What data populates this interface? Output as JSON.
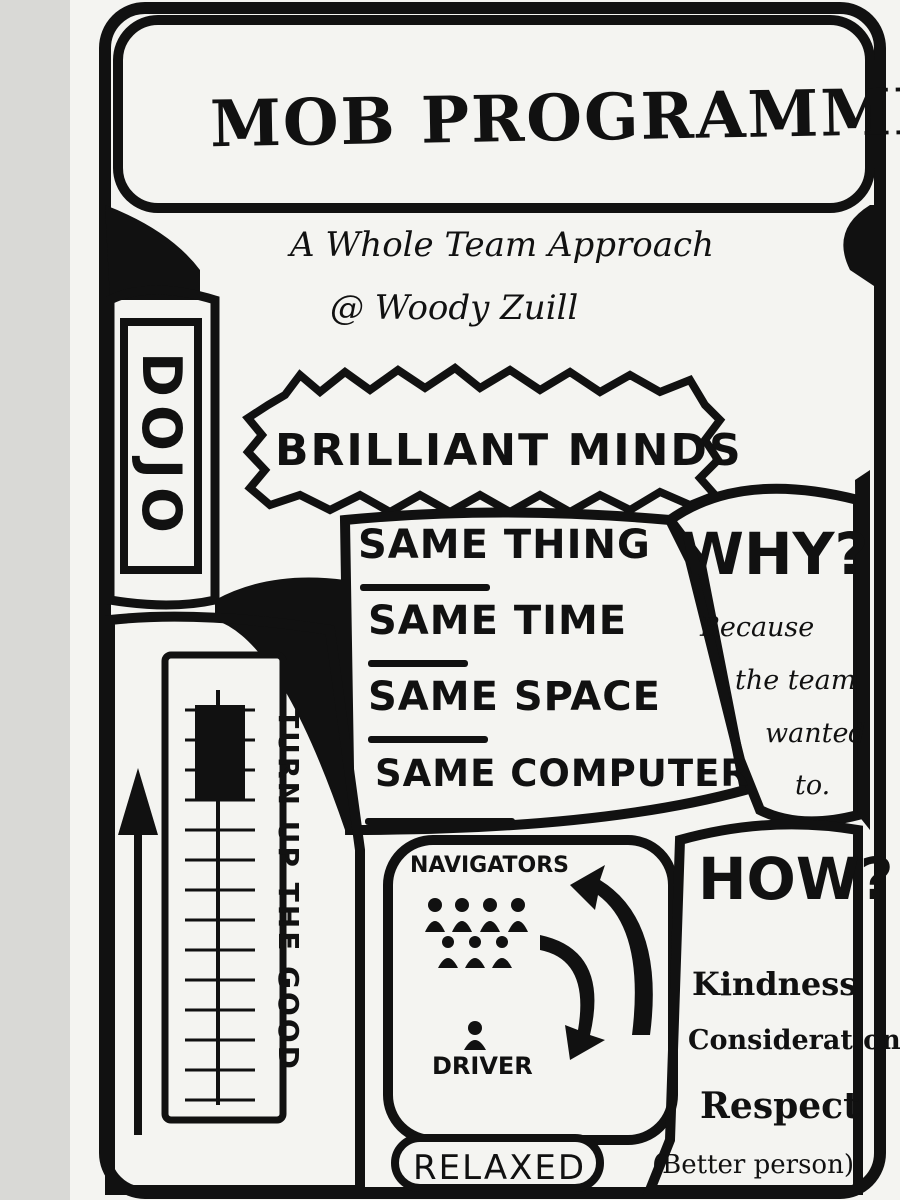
{
  "title": "MOB PROGRAMMING",
  "subtitle": "A Whole Team Approach",
  "author": "@ Woody Zuill",
  "dojo": "DOJO",
  "brilliant_minds": "BRILLIANT MINDS",
  "same": {
    "items": [
      "SAME THING",
      "SAME TIME",
      "SAME SPACE",
      "SAME COMPUTER"
    ]
  },
  "why": {
    "heading": "WHY?",
    "lines": [
      "Because",
      "the team",
      "wanted",
      "to."
    ]
  },
  "how": {
    "heading": "HOW?",
    "items": [
      "Kindness",
      "Consideration",
      "Respect"
    ],
    "note": "(Better person)"
  },
  "turn_up": "TURN UP THE GOOD",
  "mob": {
    "navigators": "NAVIGATORS",
    "driver": "DRIVER"
  },
  "relaxed": "RELAXED",
  "colors": {
    "ink": "#111111",
    "paper": "#f4f4f1",
    "background": "#d9d9d6"
  }
}
